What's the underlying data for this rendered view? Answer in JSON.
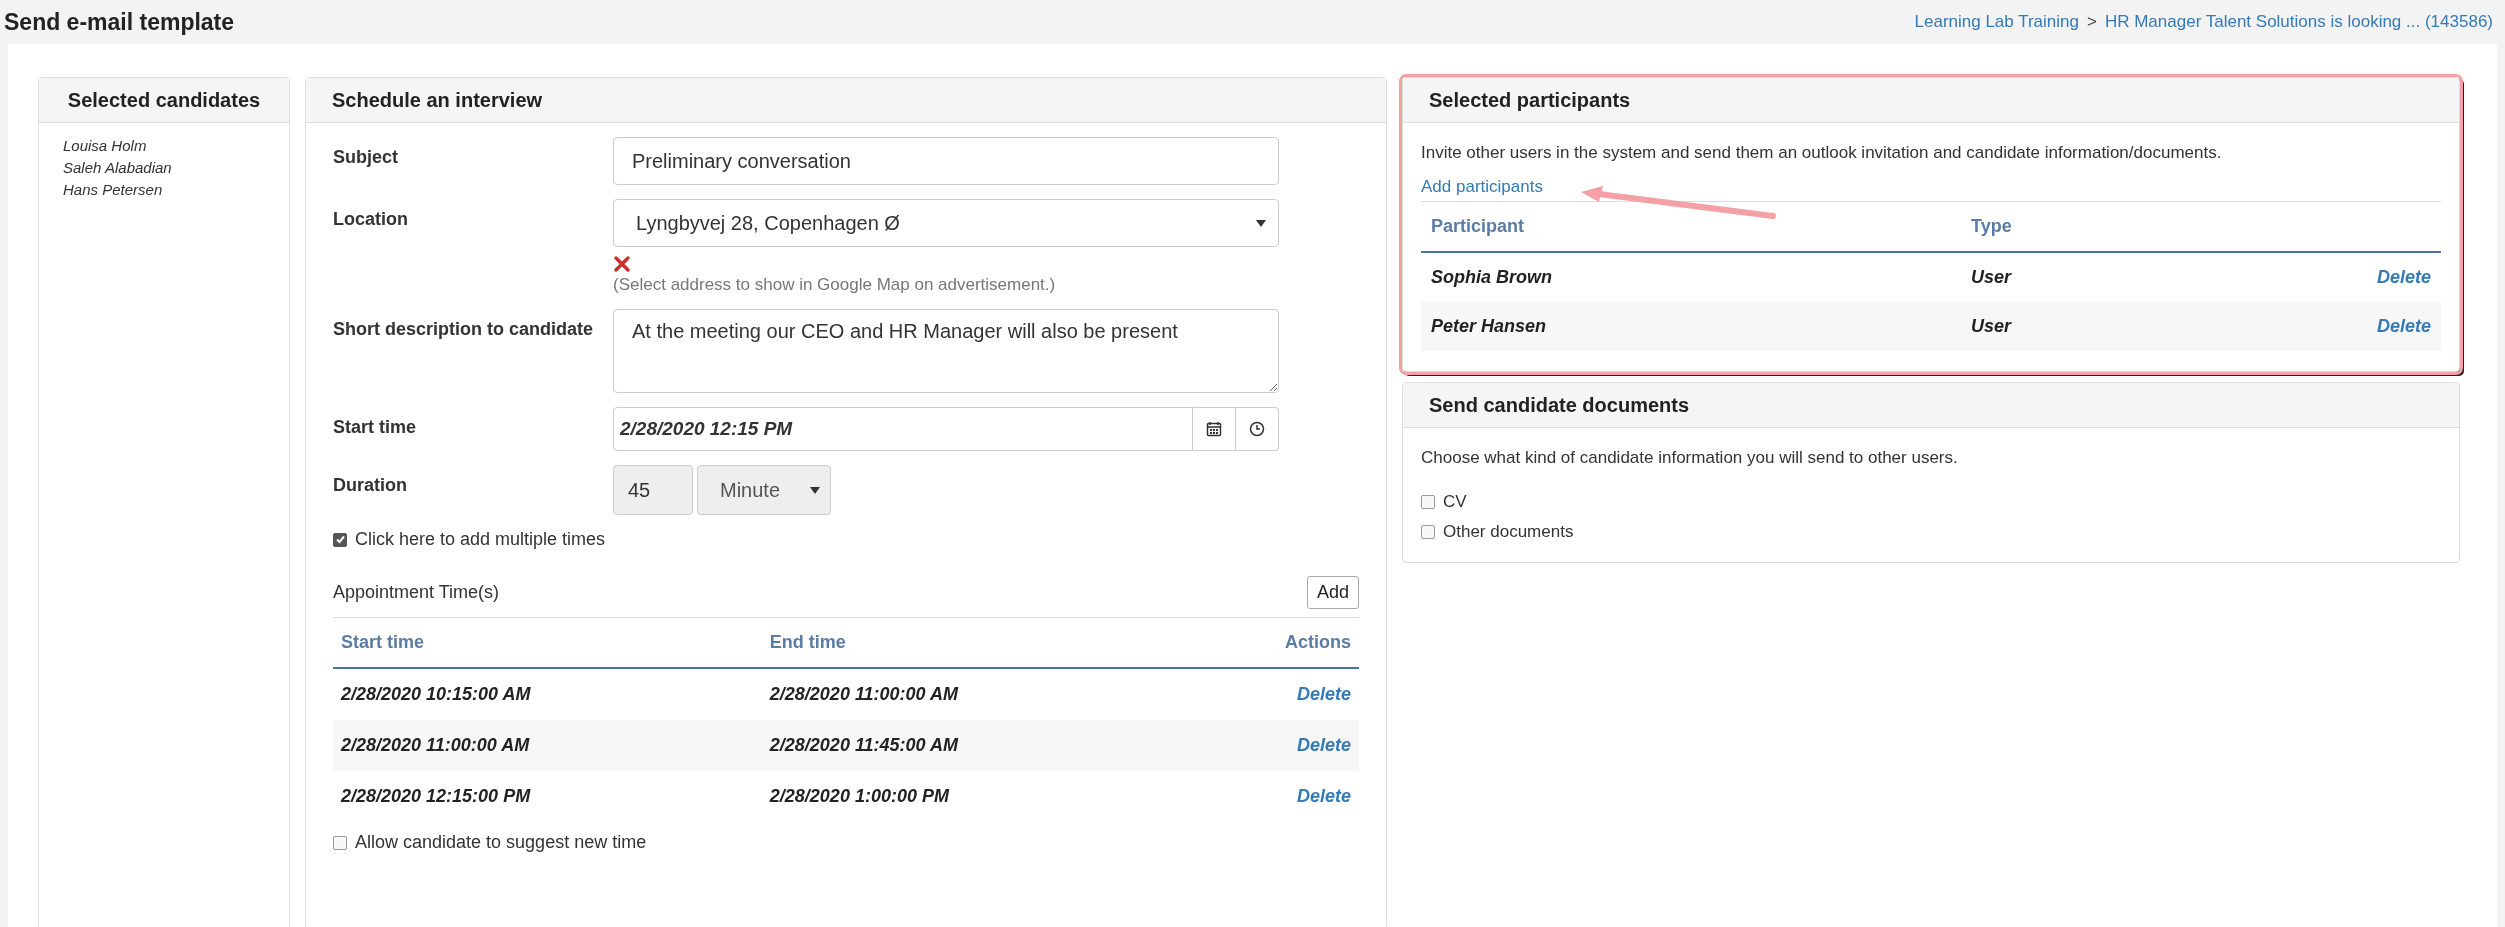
{
  "page_title": "Send e-mail template",
  "breadcrumb": {
    "items": [
      "Learning Lab Training",
      "HR Manager Talent Solutions is looking ... (143586)"
    ],
    "separator": ">"
  },
  "candidates_panel": {
    "title": "Selected candidates",
    "names": [
      "Louisa Holm",
      "Saleh Alabadian",
      "Hans Petersen"
    ]
  },
  "schedule_panel": {
    "title": "Schedule an interview",
    "fields": [
      {
        "kind": "text",
        "label": "Subject",
        "value": "Preliminary conversation"
      },
      {
        "kind": "select",
        "label": "Location",
        "value": "Lyngbyvej 28, Copenhagen Ø",
        "hint": "(Select address to show in Google Map on advertisement.)"
      },
      {
        "kind": "textarea",
        "label": "Short description to candidate",
        "value": "At the meeting our CEO and HR Manager will also be present"
      },
      {
        "kind": "datetime",
        "label": "Start time",
        "value": "2/28/2020 12:15 PM"
      },
      {
        "kind": "duration",
        "label": "Duration",
        "value": "45",
        "unit": "Minute"
      }
    ],
    "multiple_times": {
      "label": "Click here to add multiple times",
      "checked": true
    },
    "appointments": {
      "title": "Appointment Time(s)",
      "add_button": "Add",
      "columns": [
        "Start time",
        "End time",
        "Actions"
      ],
      "rows": [
        {
          "start": "2/28/2020 10:15:00 AM",
          "end": "2/28/2020 11:00:00 AM",
          "action": "Delete"
        },
        {
          "start": "2/28/2020 11:00:00 AM",
          "end": "2/28/2020 11:45:00 AM",
          "action": "Delete"
        },
        {
          "start": "2/28/2020 12:15:00 PM",
          "end": "2/28/2020 1:00:00 PM",
          "action": "Delete"
        }
      ]
    },
    "suggest_time": {
      "label": "Allow candidate to suggest new time",
      "checked": false
    }
  },
  "participants_panel": {
    "title": "Selected participants",
    "highlighted": true,
    "description": "Invite other users in the system and send them an outlook invitation and candidate information/documents.",
    "add_link": "Add participants",
    "columns": [
      "Participant",
      "Type"
    ],
    "rows": [
      {
        "name": "Sophia Brown",
        "type": "User",
        "action": "Delete"
      },
      {
        "name": "Peter Hansen",
        "type": "User",
        "action": "Delete"
      }
    ]
  },
  "documents_panel": {
    "title": "Send candidate documents",
    "description": "Choose what kind of candidate information you will send to other users.",
    "options": [
      {
        "label": "CV",
        "checked": false
      },
      {
        "label": "Other documents",
        "checked": false
      }
    ]
  }
}
